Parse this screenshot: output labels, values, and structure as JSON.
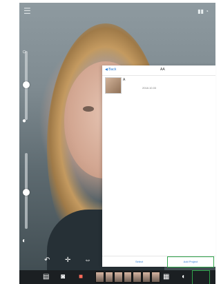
{
  "dialog": {
    "back_label": "◀ Back",
    "title": "AA",
    "project": {
      "name": "A",
      "date": "2018.10.03"
    },
    "select_label": "Select",
    "add_label": "Add Project"
  },
  "colors": {
    "accent_blue": "#2b7bd4",
    "highlight_green": "#2fa34a"
  },
  "icons": [
    "menu-icon",
    "sun-icon",
    "lamp-icon",
    "contrast-icon",
    "rotate-icon",
    "crosshair-icon",
    "flip-icon",
    "gallery-icon",
    "camera-icon",
    "video-icon",
    "grid-icon",
    "share-icon"
  ]
}
